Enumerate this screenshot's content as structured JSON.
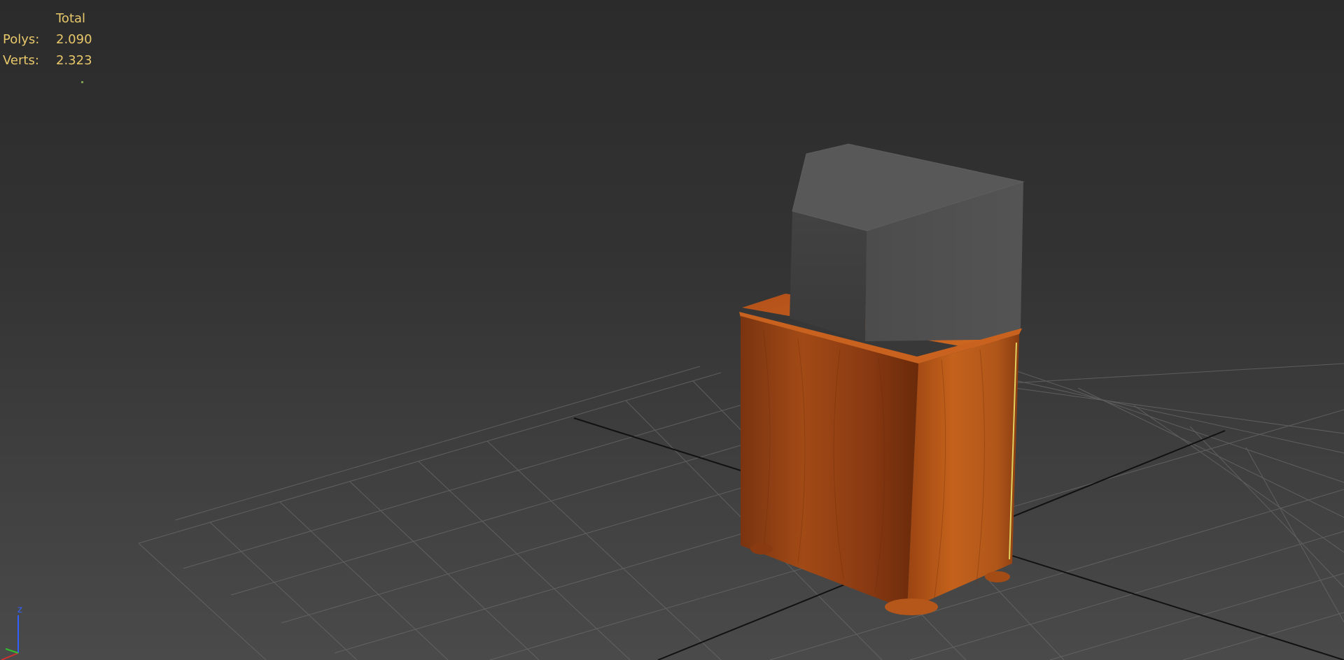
{
  "viewport": {
    "name": "perspective-viewport",
    "background": "#333333"
  },
  "stats": {
    "header": "Total",
    "polys_label": "Polys:",
    "polys_value": "2.090",
    "verts_label": "Verts:",
    "verts_value": "2.323",
    "color": "#e8c86a"
  },
  "scene": {
    "objects": [
      {
        "name": "wooden-cabinet",
        "material": "wood",
        "color": "#b5561a"
      },
      {
        "name": "crt-monitor",
        "material": "grey",
        "color": "#5a5a5a"
      }
    ],
    "grid": {
      "visible": true,
      "color": "#6a6a6a"
    }
  },
  "axis_gizmo": {
    "z_label": "z",
    "colors": {
      "x": "#d03030",
      "y": "#30c030",
      "z": "#3060ff"
    }
  }
}
